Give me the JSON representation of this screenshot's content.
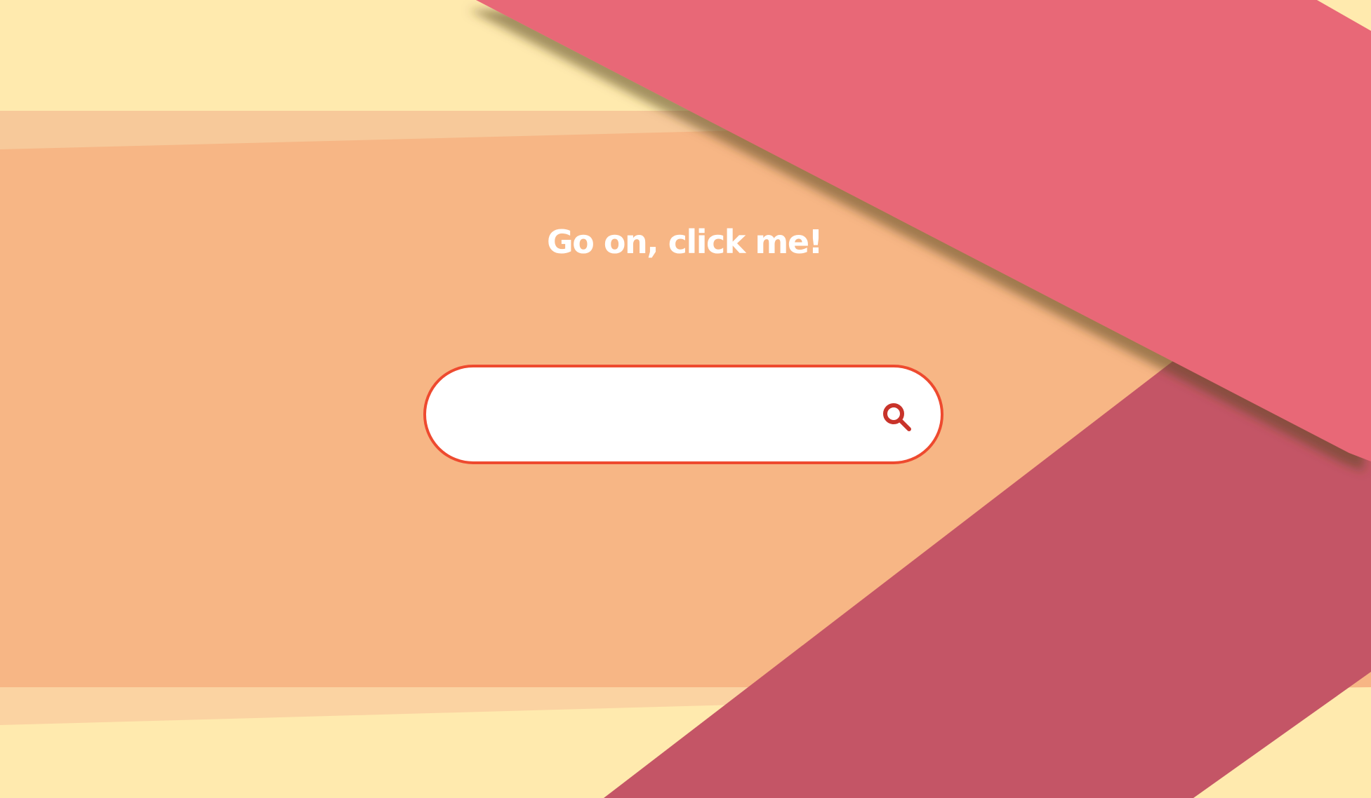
{
  "prompt": {
    "text": "Go on, click me!"
  },
  "search": {
    "value": "",
    "placeholder": "",
    "icon": "search-icon"
  },
  "colors": {
    "background_cream": "#ffeaae",
    "band_orange": "#f7b685",
    "band_stripe_light": "#f7c99a",
    "ribbon_pink": "#e86877",
    "ribbon_dark": "#c45566",
    "search_border": "#ee4a2f",
    "search_icon": "#c8332a",
    "prompt_text": "#ffffff"
  }
}
